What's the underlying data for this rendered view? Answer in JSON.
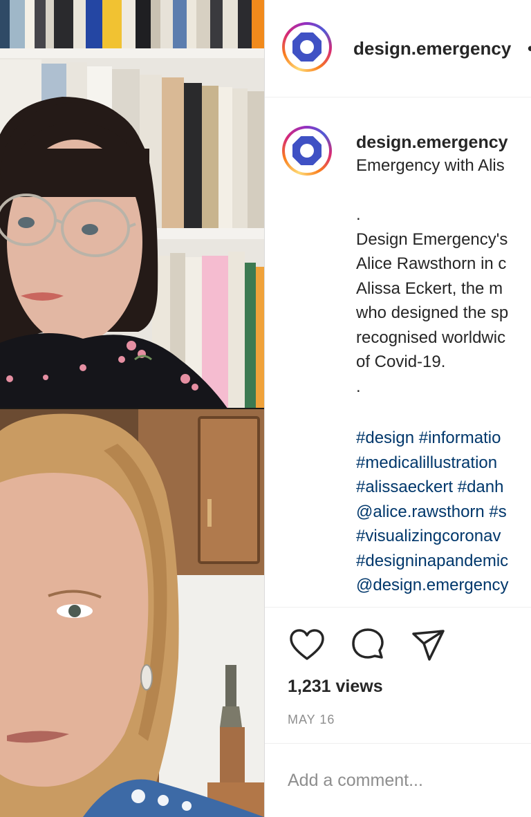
{
  "post": {
    "username": "design.emergency",
    "header_suffix": "•",
    "caption_lines": [
      "Emergency with Alis",
      "",
      ".",
      "Design Emergency's",
      "Alice Rawsthorn in c",
      "Alissa Eckert, the m",
      "who designed the sp",
      "recognised worldwic",
      "of Covid-19.",
      "."
    ],
    "hashtag_lines": [
      "#design #informatio",
      "#medicalillustration",
      "#alissaeckert #danh",
      "@alice.rawsthorn #s",
      "#visualizingcoronav",
      "#designinapandemic",
      "@design.emergency"
    ],
    "views": "1,231 views",
    "date": "MAY 16",
    "comment_placeholder": "Add a comment..."
  },
  "icons": {
    "like": "heart-icon",
    "comment": "comment-bubble-icon",
    "share": "paper-plane-icon",
    "avatar_logo": "rounded-octagon-logo"
  },
  "colors": {
    "hashtag": "#00376b",
    "avatar_ring": [
      "#feda75",
      "#fa7e1e",
      "#d62976",
      "#962fbf",
      "#4f5bd5"
    ],
    "logo": "#3f51c4",
    "muted": "#8e8e8e"
  }
}
